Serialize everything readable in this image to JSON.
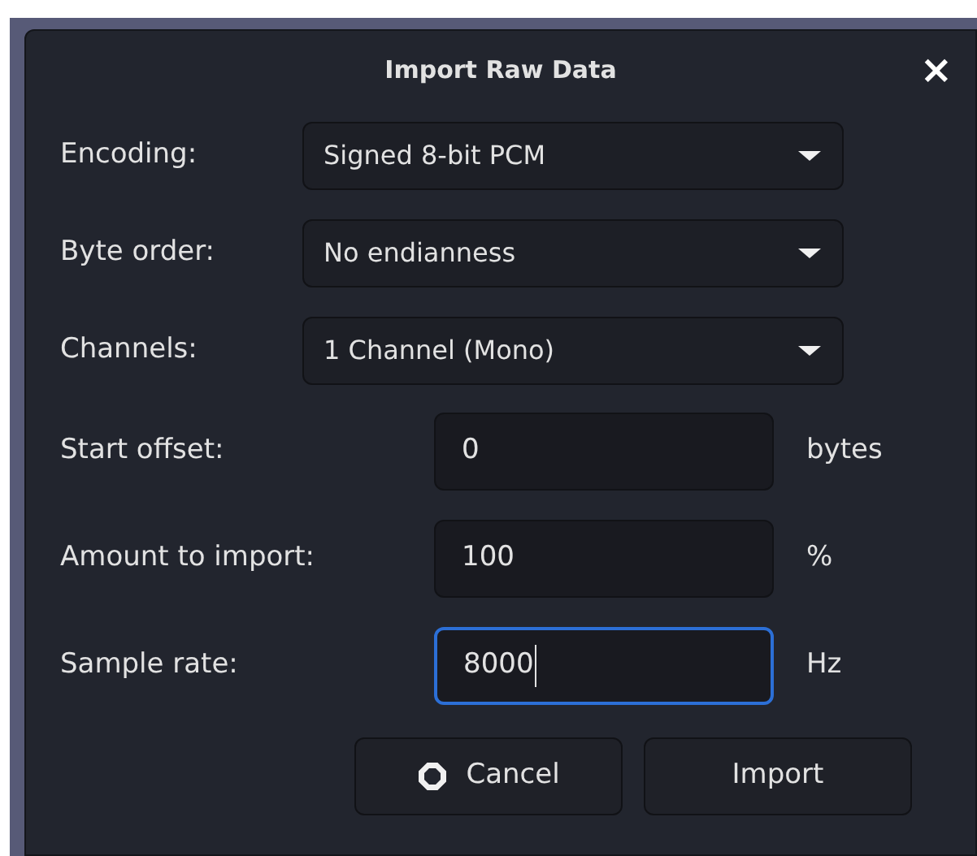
{
  "window": {
    "title": "Import Raw Data",
    "close": "×"
  },
  "dropdowns": [
    {
      "label": "Encoding:",
      "value": "Signed 8-bit PCM"
    },
    {
      "label": "Byte order:",
      "value": "No endianness"
    },
    {
      "label": "Channels:",
      "value": "1 Channel (Mono)"
    }
  ],
  "fields": [
    {
      "label": "Start offset:",
      "value": "0",
      "unit": "bytes",
      "focused": false
    },
    {
      "label": "Amount to import:",
      "value": "100",
      "unit": "%",
      "focused": false
    },
    {
      "label": "Sample rate:",
      "value": "8000",
      "unit": "Hz",
      "focused": true
    }
  ],
  "buttons": [
    {
      "label": "Cancel",
      "kind": "cancel"
    },
    {
      "label": "Import",
      "kind": "plain"
    }
  ]
}
